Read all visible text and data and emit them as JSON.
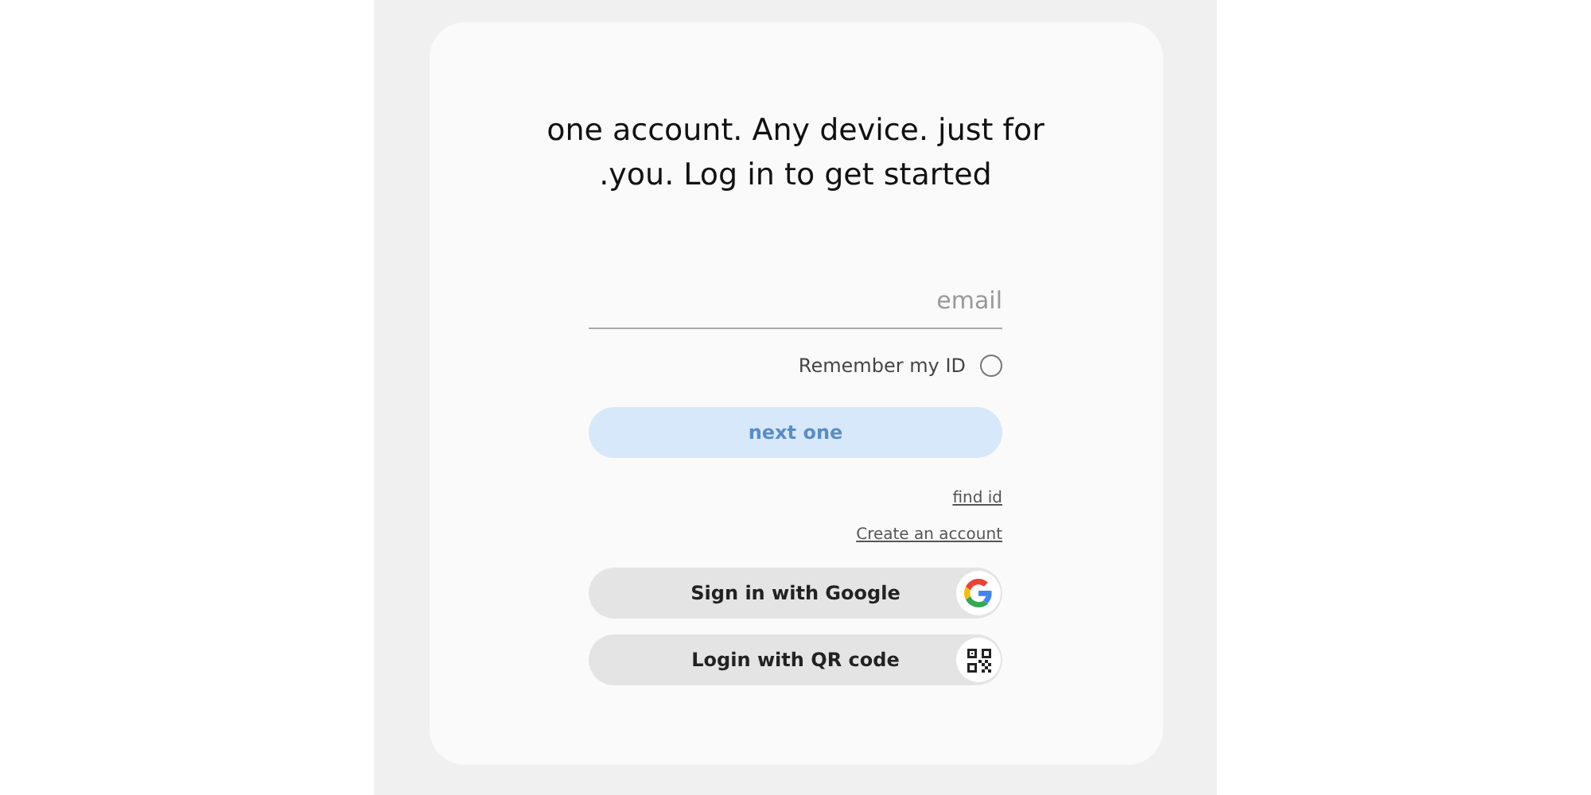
{
  "heading": "one account. Any device. just for .you. Log in to get started",
  "email": {
    "placeholder": "email"
  },
  "remember": {
    "label": "Remember my ID",
    "checked": false
  },
  "next_button": {
    "label": "next one",
    "disabled": true
  },
  "links": [
    "find id",
    "Create an account"
  ],
  "sign_in_options": [
    {
      "kind": "google",
      "label": "Sign in with Google"
    },
    {
      "kind": "qr",
      "label": "Login with QR code"
    }
  ]
}
